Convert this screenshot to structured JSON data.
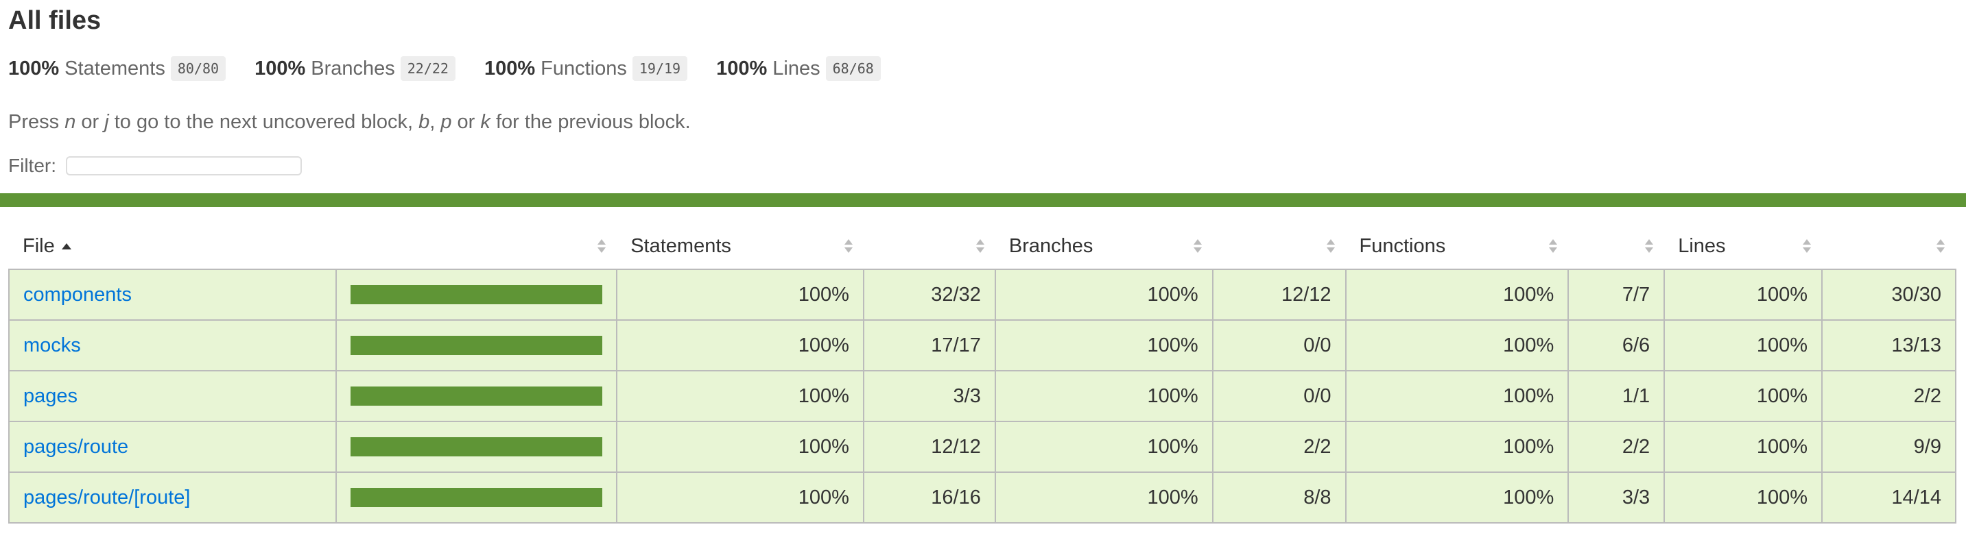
{
  "page": {
    "title": "All files",
    "summary": [
      {
        "pct": "100%",
        "label": "Statements",
        "fraction": "80/80"
      },
      {
        "pct": "100%",
        "label": "Branches",
        "fraction": "22/22"
      },
      {
        "pct": "100%",
        "label": "Functions",
        "fraction": "19/19"
      },
      {
        "pct": "100%",
        "label": "Lines",
        "fraction": "68/68"
      }
    ],
    "hint": {
      "t1": "Press ",
      "k1": "n",
      "t2": " or ",
      "k2": "j",
      "t3": " to go to the next uncovered block, ",
      "k3": "b",
      "t4": ", ",
      "k4": "p",
      "t5": " or ",
      "k5": "k",
      "t6": " for the previous block."
    },
    "filter": {
      "label": "Filter:",
      "value": ""
    },
    "status_color": "#5f9536"
  },
  "table": {
    "headers": {
      "file": "File",
      "statements": "Statements",
      "branches": "Branches",
      "functions": "Functions",
      "lines": "Lines"
    },
    "rows": [
      {
        "file": "components",
        "coverage": 1.0,
        "stmt_pct": "100%",
        "stmt_frac": "32/32",
        "br_pct": "100%",
        "br_frac": "12/12",
        "fn_pct": "100%",
        "fn_frac": "7/7",
        "ln_pct": "100%",
        "ln_frac": "30/30"
      },
      {
        "file": "mocks",
        "coverage": 1.0,
        "stmt_pct": "100%",
        "stmt_frac": "17/17",
        "br_pct": "100%",
        "br_frac": "0/0",
        "fn_pct": "100%",
        "fn_frac": "6/6",
        "ln_pct": "100%",
        "ln_frac": "13/13"
      },
      {
        "file": "pages",
        "coverage": 1.0,
        "stmt_pct": "100%",
        "stmt_frac": "3/3",
        "br_pct": "100%",
        "br_frac": "0/0",
        "fn_pct": "100%",
        "fn_frac": "1/1",
        "ln_pct": "100%",
        "ln_frac": "2/2"
      },
      {
        "file": "pages/route",
        "coverage": 1.0,
        "stmt_pct": "100%",
        "stmt_frac": "12/12",
        "br_pct": "100%",
        "br_frac": "2/2",
        "fn_pct": "100%",
        "fn_frac": "2/2",
        "ln_pct": "100%",
        "ln_frac": "9/9"
      },
      {
        "file": "pages/route/[route]",
        "coverage": 1.0,
        "stmt_pct": "100%",
        "stmt_frac": "16/16",
        "br_pct": "100%",
        "br_frac": "8/8",
        "fn_pct": "100%",
        "fn_frac": "3/3",
        "ln_pct": "100%",
        "ln_frac": "14/14"
      }
    ]
  }
}
